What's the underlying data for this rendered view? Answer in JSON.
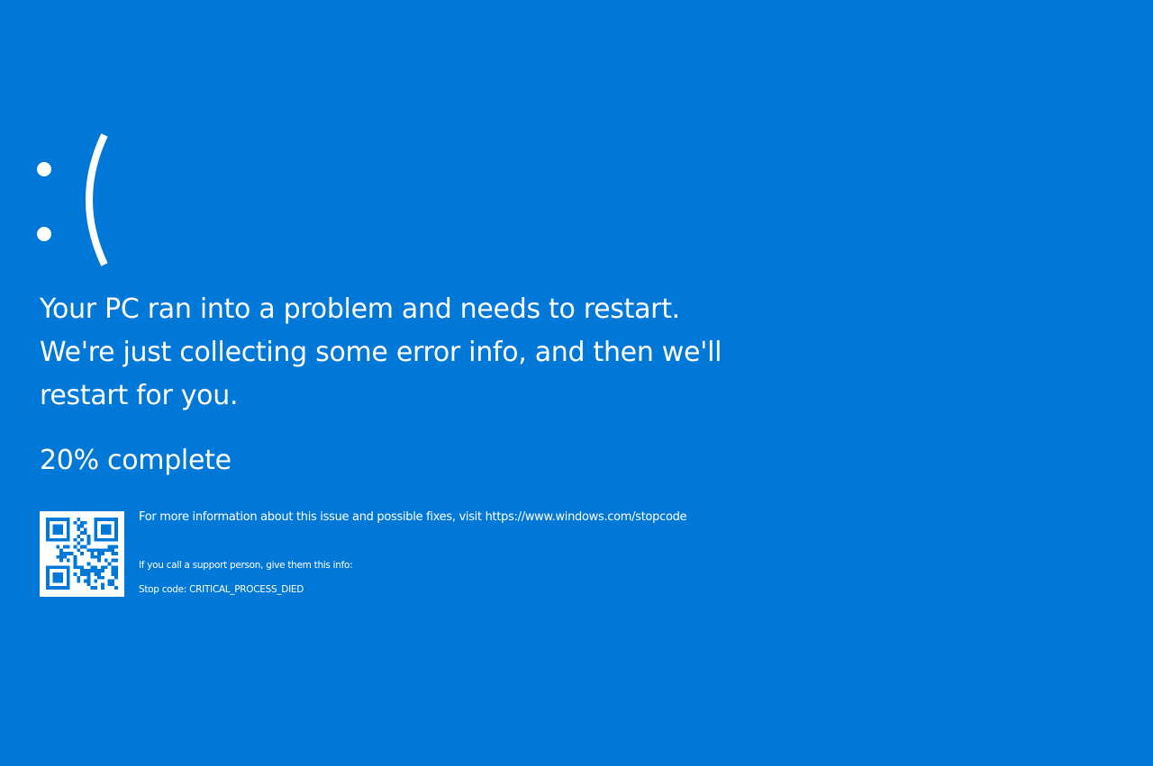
{
  "screen": {
    "background_color": "#0078d7",
    "text_color": "#ffffff",
    "sad_face_icon": "sad-face-emoticon",
    "message": "Your PC ran into a problem and needs to restart. We're just collecting some error info, and then we'll restart for you.",
    "progress_text": "20% complete",
    "progress_percent": 20,
    "more_info": "For more information about this issue and possible fixes, visit https://www.windows.com/stopcode",
    "support_note": "If you call a support person, give them this info:",
    "stop_code": "Stop code: CRITICAL_PROCESS_DIED",
    "qr_icon": "qr-code-icon"
  }
}
